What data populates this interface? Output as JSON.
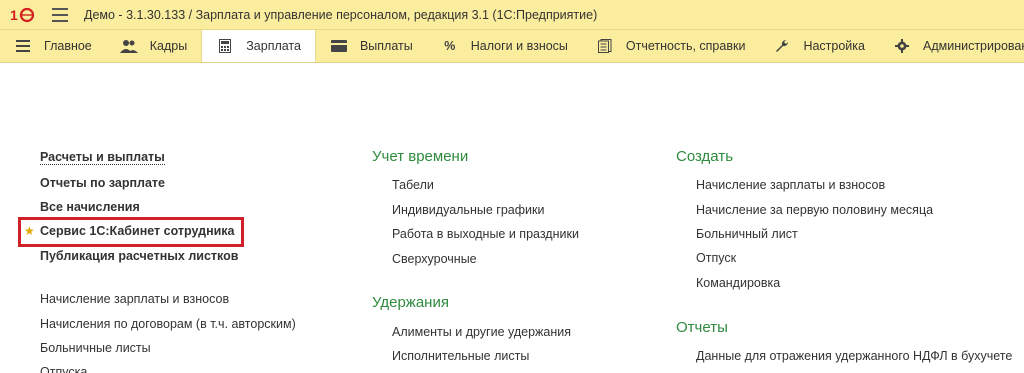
{
  "titlebar": {
    "logo": "1С",
    "title": "Демо - 3.1.30.133 / Зарплата и управление персоналом, редакция 3.1  (1С:Предприятие)"
  },
  "sections": [
    {
      "label": "Главное",
      "icon": "menu-lines-icon"
    },
    {
      "label": "Кадры",
      "icon": "people-icon"
    },
    {
      "label": "Зарплата",
      "icon": "calculator-icon",
      "active": true
    },
    {
      "label": "Выплаты",
      "icon": "wallet-icon"
    },
    {
      "label": "Налоги и взносы",
      "icon": "percent-icon"
    },
    {
      "label": "Отчетность, справки",
      "icon": "reports-icon"
    },
    {
      "label": "Настройка",
      "icon": "wrench-icon"
    },
    {
      "label": "Администрирование",
      "icon": "gear-icon"
    }
  ],
  "col1": {
    "bold_items": [
      "Расчеты и выплаты",
      "Отчеты по зарплате",
      "Все начисления",
      "Сервис 1С:Кабинет сотрудника",
      "Публикация расчетных листков"
    ],
    "items": [
      "Начисление зарплаты и взносов",
      "Начисления по договорам (в т.ч. авторским)",
      "Больничные листы",
      "Отпуска"
    ]
  },
  "col2": {
    "groups": [
      {
        "title": "Учет времени",
        "items": [
          "Табели",
          "Индивидуальные графики",
          "Работа в выходные и праздники",
          "Сверхурочные"
        ]
      },
      {
        "title": "Удержания",
        "items": [
          "Алименты и другие удержания",
          "Исполнительные листы"
        ]
      }
    ]
  },
  "col3": {
    "groups": [
      {
        "title": "Создать",
        "items": [
          "Начисление зарплаты и взносов",
          "Начисление за первую половину месяца",
          "Больничный лист",
          "Отпуск",
          "Командировка"
        ]
      },
      {
        "title": "Отчеты",
        "items": [
          "Данные для отражения удержанного НДФЛ в бухучете"
        ]
      }
    ]
  },
  "colors": {
    "panel_bg": "#fbed9e",
    "group_title": "#2e8b3e",
    "highlight": "#d0202a",
    "star": "#e0a800"
  }
}
